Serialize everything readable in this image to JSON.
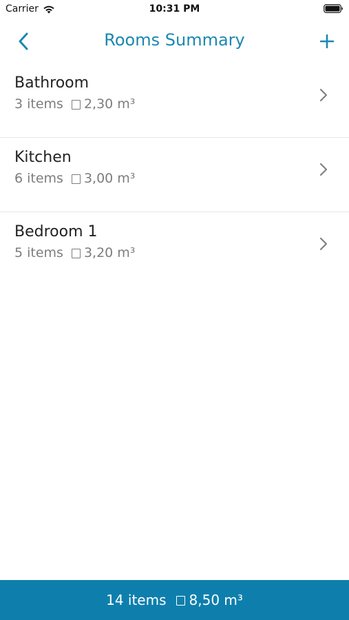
{
  "status_bar": {
    "carrier": "Carrier",
    "time": "10:31 PM"
  },
  "nav": {
    "title": "Rooms Summary",
    "back_icon": "chevron-left-icon",
    "add_icon": "plus-icon"
  },
  "rooms": [
    {
      "name": "Bathroom",
      "items": "3 items",
      "volume": "2,30 m³"
    },
    {
      "name": "Kitchen",
      "items": "6 items",
      "volume": "3,00 m³"
    },
    {
      "name": "Bedroom 1",
      "items": "5 items",
      "volume": "3,20 m³"
    }
  ],
  "footer": {
    "items": "14 items",
    "volume": "8,50 m³"
  },
  "colors": {
    "accent": "#1b87b1",
    "footer_background": "#0e7fac",
    "secondary_text": "#7d7d7d"
  }
}
